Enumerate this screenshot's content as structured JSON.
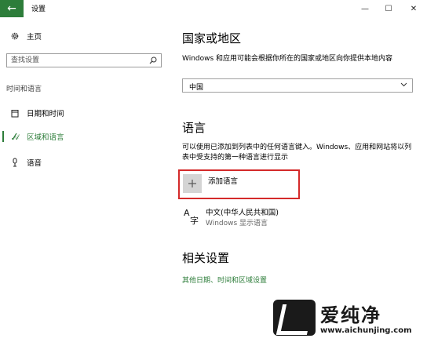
{
  "window": {
    "title": "设置",
    "back_glyph": "←",
    "minimize_glyph": "—",
    "maximize_glyph": "☐",
    "close_glyph": "✕"
  },
  "sidebar": {
    "home_label": "主页",
    "search": {
      "placeholder": "查找设置",
      "value": ""
    },
    "section_label": "时间和语言",
    "items": [
      {
        "label": "日期和时间",
        "icon": "calendar-icon",
        "selected": false
      },
      {
        "label": "区域和语言",
        "icon": "region-language-icon",
        "selected": true
      },
      {
        "label": "语音",
        "icon": "microphone-icon",
        "selected": false
      }
    ]
  },
  "main": {
    "country_heading": "国家或地区",
    "country_description": "Windows 和应用可能会根据你所在的国家或地区向你提供本地内容",
    "country_selected": "中国",
    "language_heading": "语言",
    "language_description": "可以使用已添加到列表中的任何语言键入。Windows、应用和网站将以列表中受支持的第一种语言进行显示",
    "add_language_label": "添加语言",
    "language_list": [
      {
        "name": "中文(中华人民共和国)",
        "subtitle": "Windows 显示语言"
      }
    ],
    "related_heading": "相关设置",
    "related_link": "其他日期、时间和区域设置"
  },
  "watermark": {
    "text": "爱纯净",
    "url": "www.aichunjing.com"
  },
  "colors": {
    "accent": "#2d7d3a",
    "highlight_border": "#d42a2a"
  }
}
